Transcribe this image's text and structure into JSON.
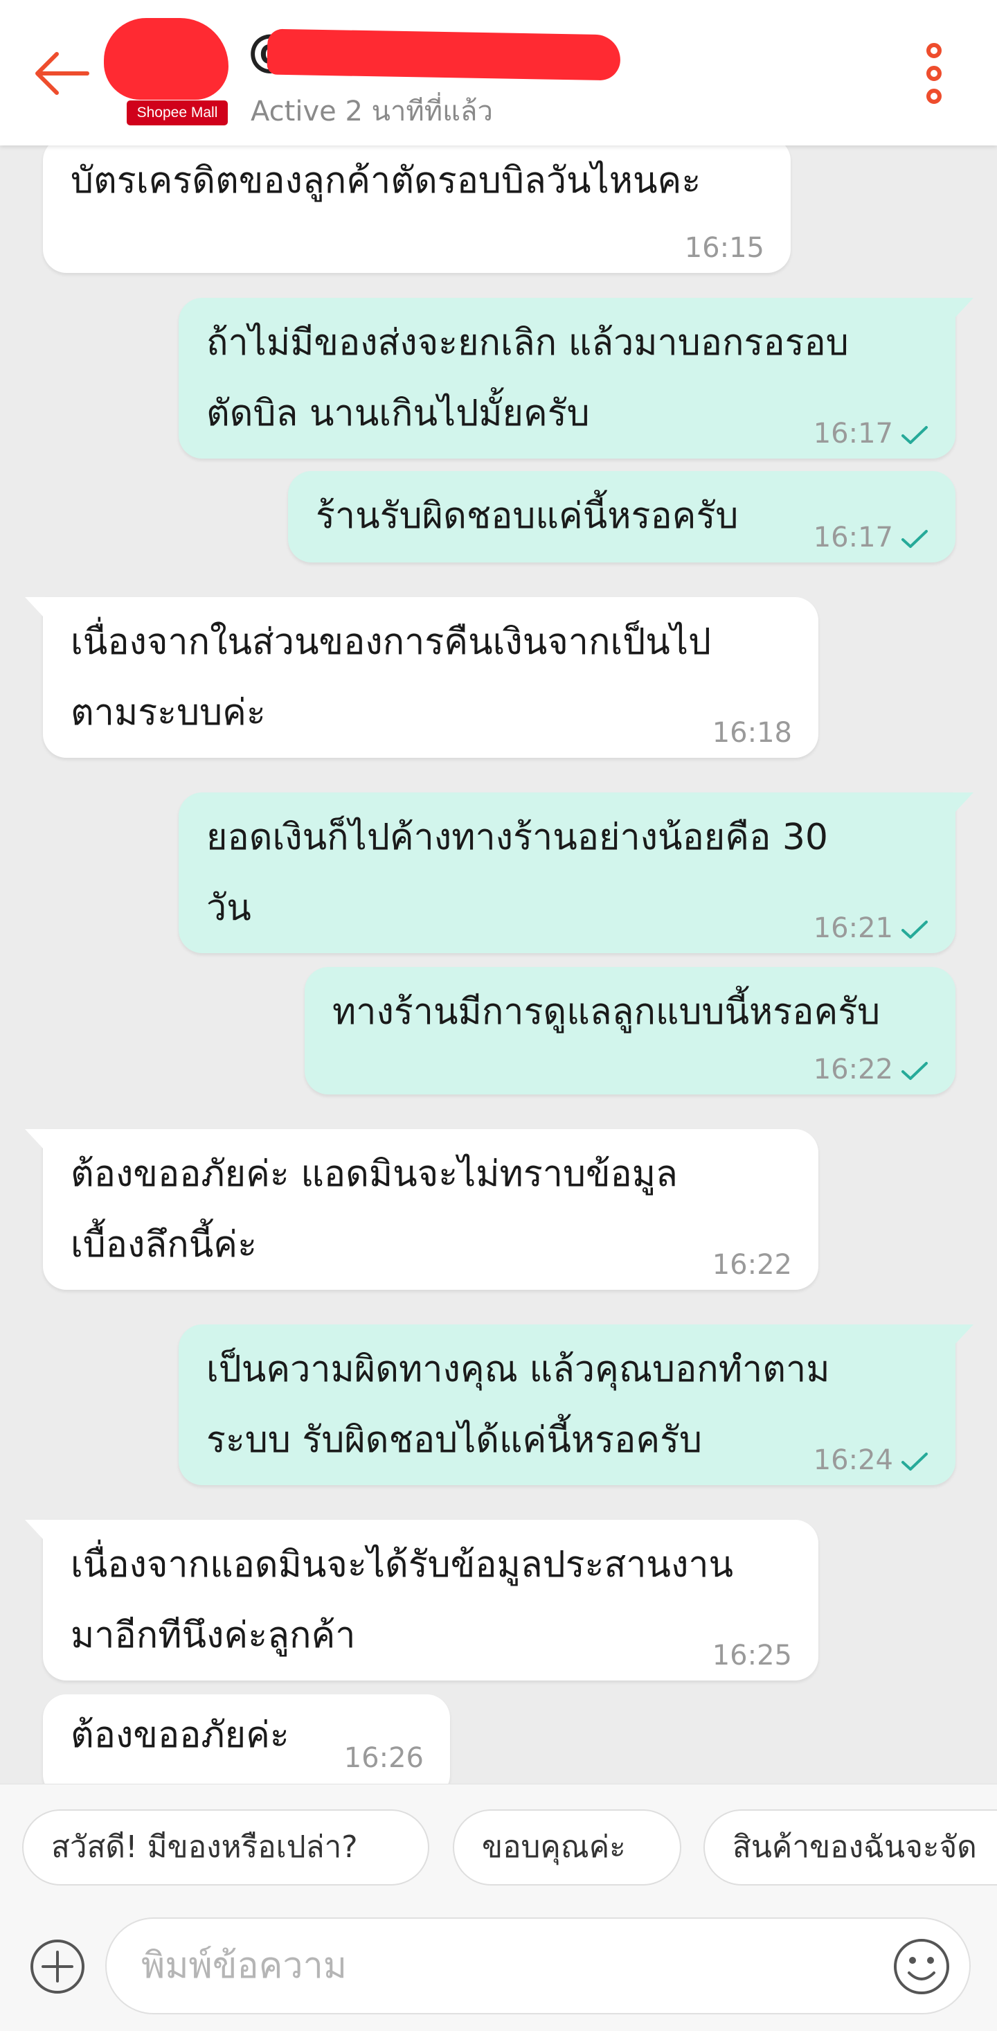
{
  "header": {
    "shop_name": "@",
    "avatar_badge": "Shopee Mall",
    "status": "Active 2 นาทีที่แล้ว",
    "accent_color": "#ee4d2d",
    "icons": [
      "back-arrow-icon",
      "more-vert-icon"
    ]
  },
  "messages": [
    {
      "dir": "in",
      "text": "บัตรเครดิตของลูกค้าตัดรอบบิลวันไหนคะ",
      "time": "16:15"
    },
    {
      "dir": "out",
      "text": "ถ้าไม่มีของส่งจะยกเลิก แล้วมาบอกรอรอบ\nตัดบิล นานเกินไปมั้ยครับ",
      "time": "16:17",
      "read": true
    },
    {
      "dir": "out",
      "text": "ร้านรับผิดชอบแค่นี้หรอครับ",
      "time": "16:17",
      "read": true
    },
    {
      "dir": "in",
      "text": "เนื่องจากในส่วนของการคืนเงินจากเป็นไป\nตามระบบค่ะ",
      "time": "16:18"
    },
    {
      "dir": "out",
      "text": "ยอดเงินก็ไปค้างทางร้านอย่างน้อยคือ 30\nวัน",
      "time": "16:21",
      "read": true
    },
    {
      "dir": "out",
      "text": "ทางร้านมีการดูแลลูกแบบนี้หรอครับ",
      "time": "16:22",
      "read": true
    },
    {
      "dir": "in",
      "text": "ต้องขออภัยค่ะ แอดมินจะไม่ทราบข้อมูล\nเบื้องลึกนี้ค่ะ",
      "time": "16:22"
    },
    {
      "dir": "out",
      "text": "เป็นความผิดทางคุณ แล้วคุณบอกทำตาม\nระบบ รับผิดชอบได้แค่นี้หรอครับ",
      "time": "16:24",
      "read": true
    },
    {
      "dir": "in",
      "text": "เนื่องจากแอดมินจะได้รับข้อมูลประสานงาน\nมาอีกทีนึงค่ะลูกค้า",
      "time": "16:25"
    },
    {
      "dir": "in",
      "text": "ต้องขออภัยค่ะ",
      "time": "16:26"
    }
  ],
  "quick_replies": [
    "สวัสดี! มีของหรือเปล่า?",
    "ขอบคุณค่ะ",
    "สินค้าของฉันจะจัด"
  ],
  "composer": {
    "placeholder": "พิมพ์ข้อความ",
    "icons": [
      "plus-icon",
      "emoji-icon"
    ]
  },
  "colors": {
    "incoming_bubble": "#ffffff",
    "outgoing_bubble": "#d2f5ec",
    "read_check": "#26aa99",
    "chat_background": "#ececec"
  }
}
